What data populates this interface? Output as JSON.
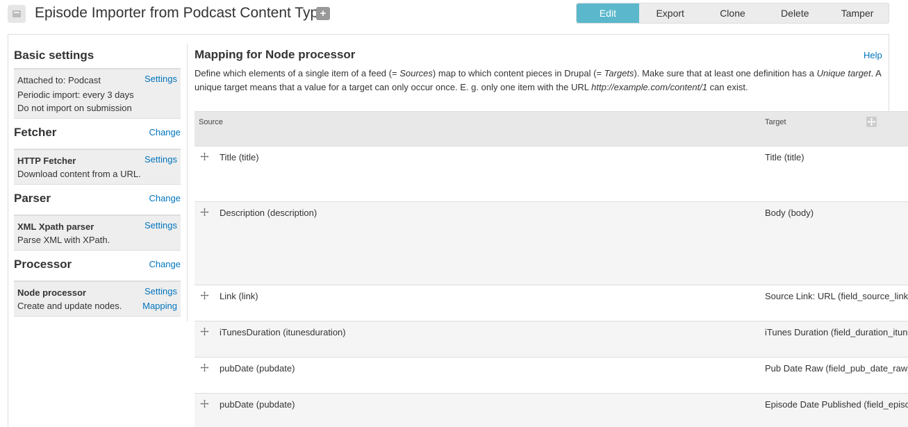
{
  "header": {
    "title": "Episode Importer from Podcast Content Type",
    "add_label": "+",
    "tabs": [
      "Edit",
      "Export",
      "Clone",
      "Delete",
      "Tamper"
    ]
  },
  "sidebar": {
    "basic": {
      "title": "Basic settings",
      "settings_label": "Settings",
      "lines": [
        "Attached to: Podcast",
        "Periodic import: every 3 days",
        "Do not import on submission"
      ]
    },
    "fetcher": {
      "title": "Fetcher",
      "change_label": "Change",
      "name": "HTTP Fetcher",
      "settings_label": "Settings",
      "description": "Download content from a URL."
    },
    "parser": {
      "title": "Parser",
      "change_label": "Change",
      "name": "XML Xpath parser",
      "settings_label": "Settings",
      "description": "Parse XML with XPath."
    },
    "processor": {
      "title": "Processor",
      "change_label": "Change",
      "name": "Node processor",
      "settings_label": "Settings",
      "mapping_label": "Mapping",
      "description": "Create and update nodes."
    }
  },
  "main": {
    "title": "Mapping for Node processor",
    "help_label": "Help",
    "description": {
      "p1": "Define which elements of a single item of a feed (= ",
      "sources": "Sources",
      "p2": ") map to which content pieces in Drupal (= ",
      "targets": "Targets",
      "p3": "). Make sure that at least one definition has a ",
      "unique": "Unique target",
      "p4": ". A unique target means that a value for a target can only occur once. E. g. only one item with the URL ",
      "url": "http://example.com/content/1",
      "p5": " can exist."
    },
    "table": {
      "source_header": "Source",
      "target_header": "Target",
      "rows": [
        {
          "source": "Title (title)",
          "target": "Title (title)"
        },
        {
          "source": "Description (description)",
          "target": "Body (body)"
        },
        {
          "source": "Link (link)",
          "target": "Source Link: URL (field_source_link:url)"
        },
        {
          "source": "iTunesDuration (itunesduration)",
          "target": "iTunes Duration (field_duration_itunes)"
        },
        {
          "source": "pubDate (pubdate)",
          "target": "Pub Date Raw (field_pub_date_raw)"
        },
        {
          "source": "pubDate (pubdate)",
          "target": "Episode Date Published (field_episode_date)"
        }
      ]
    }
  },
  "colors": {
    "active_tab": "#5bb8cc",
    "link": "#0074bd"
  }
}
